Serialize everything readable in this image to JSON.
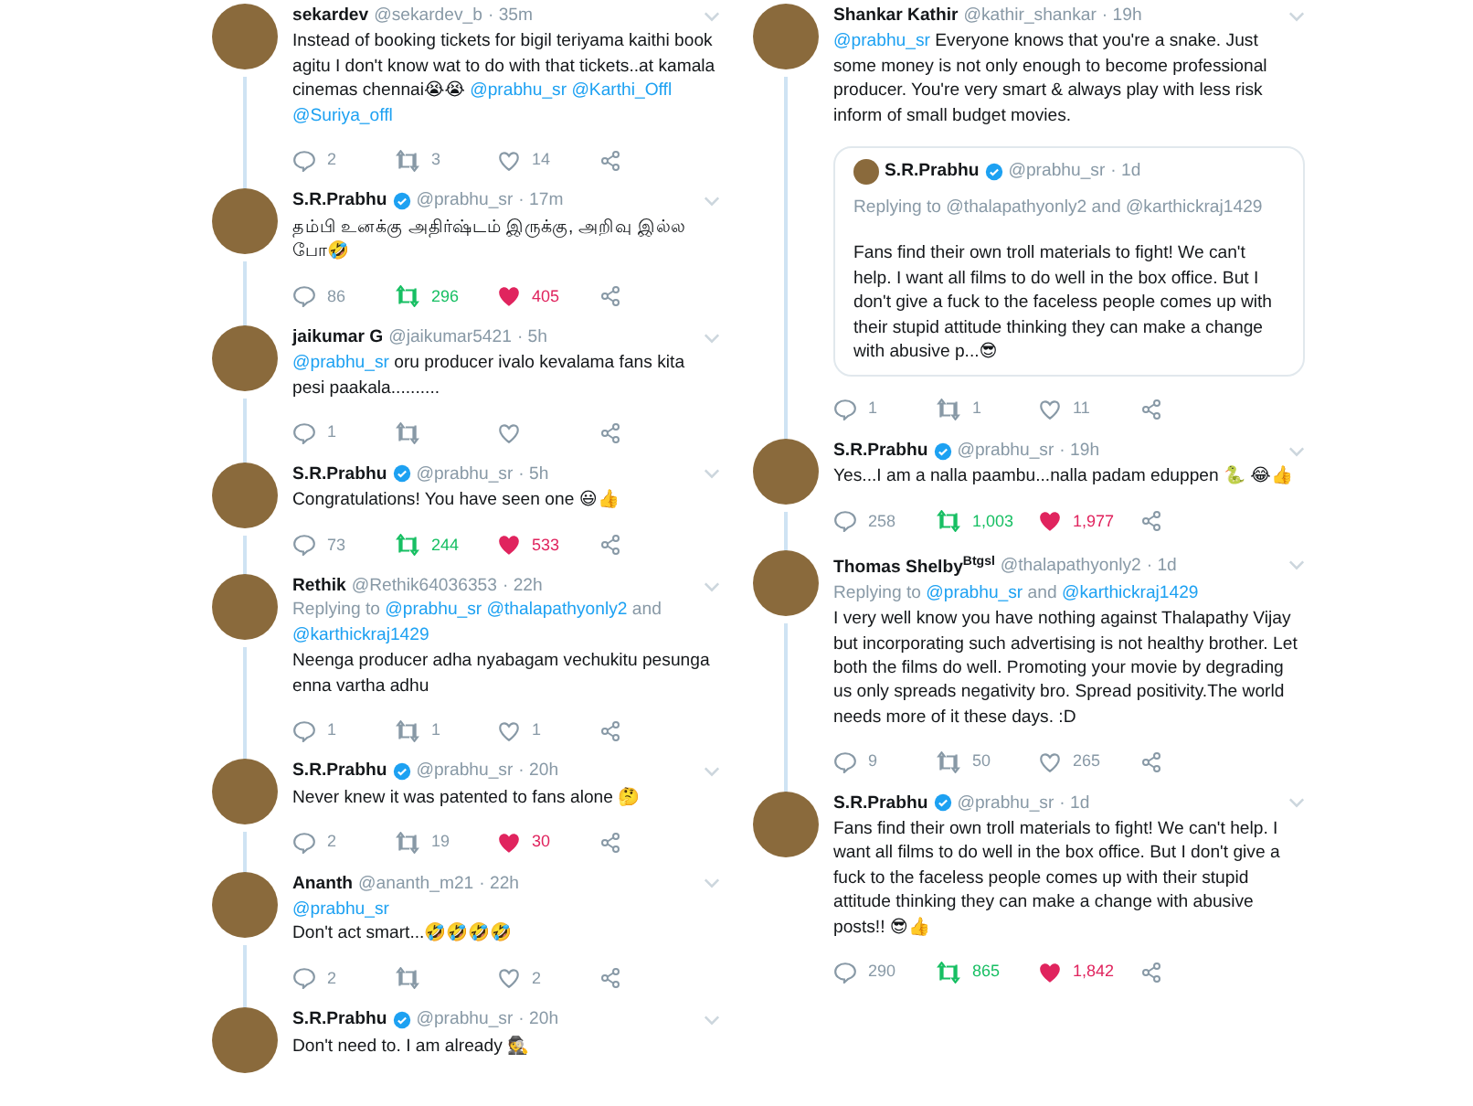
{
  "columns": [
    {
      "tweets": [
        {
          "name": "sekardev",
          "verified": false,
          "handle": "@sekardev_b",
          "time": "· 35m",
          "text": [
            {
              "kind": "plain",
              "text": "Instead of booking tickets for bigil teriyama kaithi book agitu I don't know wat to do with that tickets..at kamala cinemas chennai😭😭 "
            },
            {
              "kind": "mention",
              "text": "@prabhu_sr @Karthi_Offl @Suriya_offl"
            }
          ],
          "actions": {
            "replies": "2",
            "retweets": "3",
            "likes": "14",
            "retweeted": false,
            "liked": false
          }
        },
        {
          "name": "S.R.Prabhu",
          "verified": true,
          "handle": "@prabhu_sr",
          "time": "· 17m",
          "text": [
            {
              "kind": "plain",
              "text": "தம்பி உனக்கு அதிர்ஷ்டம் இருக்கு, அறிவு இல்ல போ🤣"
            }
          ],
          "actions": {
            "replies": "86",
            "retweets": "296",
            "likes": "405",
            "retweeted": true,
            "liked": true
          }
        },
        {
          "name": "jaikumar G",
          "verified": false,
          "handle": "@jaikumar5421",
          "time": "· 5h",
          "text": [
            {
              "kind": "mention",
              "text": "@prabhu_sr"
            },
            {
              "kind": "plain",
              "text": "  oru producer ivalo kevalama fans kita pesi paakala.........."
            }
          ],
          "actions": {
            "replies": "1",
            "retweeted": false,
            "liked": false
          }
        },
        {
          "name": "S.R.Prabhu",
          "verified": true,
          "handle": "@prabhu_sr",
          "time": "· 5h",
          "text": [
            {
              "kind": "plain",
              "text": "Congratulations! You have seen one 😃👍"
            }
          ],
          "actions": {
            "replies": "73",
            "retweets": "244",
            "likes": "533",
            "retweeted": true,
            "liked": true
          }
        },
        {
          "name": "Rethik",
          "verified": false,
          "handle": "@Rethik64036353",
          "time": "· 22h",
          "replying_to": [
            {
              "kind": "plain",
              "text": "Replying to "
            },
            {
              "kind": "mention",
              "text": "@prabhu_sr @thalapathyonly2"
            },
            {
              "kind": "plain",
              "text": " and "
            },
            {
              "kind": "mention",
              "text": "@karthickraj1429"
            }
          ],
          "text": [
            {
              "kind": "plain",
              "text": "Neenga producer adha nyabagam vechukitu pesunga enna vartha adhu"
            }
          ],
          "actions": {
            "replies": "1",
            "retweets": "1",
            "likes": "1",
            "retweeted": false,
            "liked": false
          }
        },
        {
          "name": "S.R.Prabhu",
          "verified": true,
          "handle": "@prabhu_sr",
          "time": "· 20h",
          "text": [
            {
              "kind": "plain",
              "text": "Never knew it was patented to fans alone 🤔"
            }
          ],
          "actions": {
            "replies": "2",
            "retweets": "19",
            "likes": "30",
            "retweeted": false,
            "liked": true
          }
        },
        {
          "name": "Ananth",
          "verified": false,
          "handle": "@ananth_m21",
          "time": "· 22h",
          "text": [
            {
              "kind": "mention",
              "text": "@prabhu_sr"
            },
            {
              "kind": "break"
            },
            {
              "kind": "plain",
              "text": "Don't act smart...🤣🤣🤣🤣"
            }
          ],
          "actions": {
            "replies": "2",
            "likes": "2",
            "retweeted": false,
            "liked": false
          }
        },
        {
          "name": "S.R.Prabhu",
          "verified": true,
          "handle": "@prabhu_sr",
          "time": "· 20h",
          "text": [
            {
              "kind": "plain",
              "text": "Don't need to. I am already 🕵"
            }
          ]
        }
      ]
    },
    {
      "tweets": [
        {
          "name": "Shankar Kathir",
          "verified": false,
          "handle": "@kathir_shankar",
          "time": "· 19h",
          "text": [
            {
              "kind": "mention",
              "text": "@prabhu_sr"
            },
            {
              "kind": "plain",
              "text": " Everyone knows that you're a snake. Just some money is not only enough to become professional producer. You're very smart & always play with less risk inform of small budget movies."
            }
          ],
          "quote": {
            "name": "S.R.Prabhu",
            "verified": true,
            "handle": "@prabhu_sr",
            "time": "· 1d",
            "replying_to": [
              {
                "kind": "plain",
                "text": "Replying to @thalapathyonly2 and @karthickraj1429"
              }
            ],
            "text": [
              {
                "kind": "plain",
                "text": "Fans find their own troll materials to fight! We can't help. I want all films to do well in the box office. But I don't give a fuck to the faceless people comes up with their stupid attitude thinking they can make a change with abusive p...😎"
              }
            ]
          },
          "actions": {
            "replies": "1",
            "retweets": "1",
            "likes": "11",
            "retweeted": false,
            "liked": false
          }
        },
        {
          "name": "S.R.Prabhu",
          "verified": true,
          "handle": "@prabhu_sr",
          "time": "· 19h",
          "text": [
            {
              "kind": "plain",
              "text": "Yes...I am a nalla paambu...nalla padam eduppen 🐍 😂👍"
            }
          ],
          "actions": {
            "replies": "258",
            "retweets": "1,003",
            "likes": "1,977",
            "retweeted": true,
            "liked": true
          }
        },
        {
          "name": "Thomas Shelby$^{Btgsl}$",
          "verified": false,
          "handle": "@thalapathyonly2",
          "time": "· 1d",
          "replying_to": [
            {
              "kind": "plain",
              "text": "Replying to "
            },
            {
              "kind": "mention",
              "text": "@prabhu_sr"
            },
            {
              "kind": "plain",
              "text": " and "
            },
            {
              "kind": "mention",
              "text": "@karthickraj1429"
            }
          ],
          "text": [
            {
              "kind": "plain",
              "text": "I very well know you have nothing against Thalapathy Vijay but incorporating such advertising is not healthy brother. Let both the films do well. Promoting your movie by degrading us only spreads negativity bro. Spread positivity.The world needs more of it these days. :D"
            }
          ],
          "actions": {
            "replies": "9",
            "retweets": "50",
            "likes": "265",
            "retweeted": false,
            "liked": false
          }
        },
        {
          "name": "S.R.Prabhu",
          "verified": true,
          "handle": "@prabhu_sr",
          "time": "· 1d",
          "text": [
            {
              "kind": "plain",
              "text": "Fans find their own troll materials to fight! We can't help. I want all films to do well in the box office. But I don't give a fuck to the faceless people comes up with their stupid attitude thinking they can make a change with abusive posts!! 😎👍"
            }
          ],
          "actions": {
            "replies": "290",
            "retweets": "865",
            "likes": "1,842",
            "retweeted": true,
            "liked": true
          }
        }
      ]
    }
  ]
}
